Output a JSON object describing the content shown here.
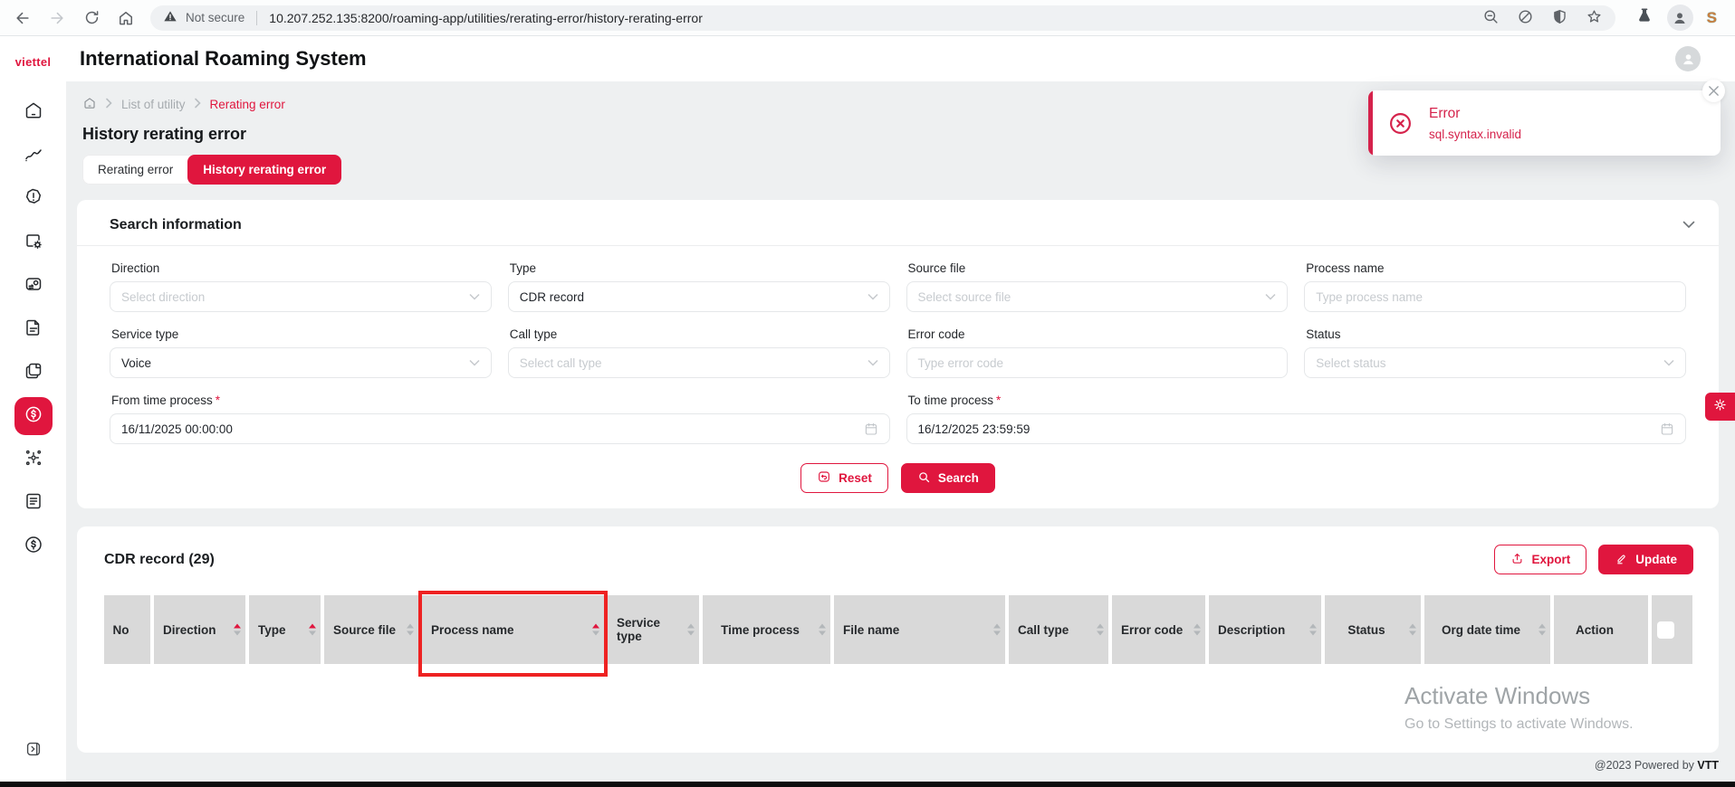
{
  "colors": {
    "accent": "#e0163e",
    "accent2": "#d5224b",
    "annotation": "#ee2222",
    "headerbg": "#d9d9d9",
    "bg": "#eef0f1",
    "placeholder": "#c7cbcf",
    "text": "#202428"
  },
  "browser": {
    "not_secure": "Not secure",
    "url": "10.207.252.135:8200/roaming-app/utilities/rerating-error/history-rerating-error",
    "extension_badge": "S"
  },
  "sidebar": {
    "logo": "viettel",
    "icons": [
      "home",
      "line-chart",
      "alert-hexagon",
      "chip-settings",
      "media-refresh",
      "document",
      "pages",
      "dollar-square",
      "network-nodes",
      "report-list",
      "dollar-circle"
    ],
    "active_icon": "dollar-square"
  },
  "header": {
    "title": "International Roaming System"
  },
  "breadcrumb": {
    "items": [
      "List of utility",
      "Rerating error"
    ]
  },
  "page": {
    "title": "History rerating error"
  },
  "tabs": [
    {
      "label": "Rerating error",
      "active": false
    },
    {
      "label": "History rerating error",
      "active": true
    }
  ],
  "toast": {
    "title": "Error",
    "message": "sql.syntax.invalid"
  },
  "search": {
    "title": "Search information",
    "required_mark": "*",
    "fields": {
      "direction": {
        "label": "Direction",
        "placeholder": "Select direction"
      },
      "type": {
        "label": "Type",
        "value": "CDR record"
      },
      "source_file": {
        "label": "Source file",
        "placeholder": "Select source file"
      },
      "process_name": {
        "label": "Process name",
        "placeholder": "Type process name"
      },
      "service_type": {
        "label": "Service type",
        "value": "Voice"
      },
      "call_type": {
        "label": "Call type",
        "placeholder": "Select call type"
      },
      "error_code": {
        "label": "Error code",
        "placeholder": "Type error code"
      },
      "status": {
        "label": "Status",
        "placeholder": "Select status"
      },
      "from_time": {
        "label": "From time process",
        "value": "16/11/2025 00:00:00",
        "required": true
      },
      "to_time": {
        "label": "To time process",
        "value": "16/12/2025 23:59:59",
        "required": true
      }
    },
    "buttons": {
      "reset": "Reset",
      "search": "Search"
    }
  },
  "results": {
    "title": "CDR record (29)",
    "export_label": "Export",
    "update_label": "Update",
    "annotated_column_index": 4,
    "columns": [
      {
        "label": "No",
        "sort": "none"
      },
      {
        "label": "Direction",
        "sort": "asc"
      },
      {
        "label": "Type",
        "sort": "asc"
      },
      {
        "label": "Source file",
        "sort": "both"
      },
      {
        "label": "Process name",
        "sort": "asc"
      },
      {
        "label": "Service type",
        "sort": "both"
      },
      {
        "label": "Time process",
        "sort": "both"
      },
      {
        "label": "File name",
        "sort": "both"
      },
      {
        "label": "Call type",
        "sort": "both"
      },
      {
        "label": "Error code",
        "sort": "both"
      },
      {
        "label": "Description",
        "sort": "both"
      },
      {
        "label": "Status",
        "sort": "both"
      },
      {
        "label": "Org date time",
        "sort": "both"
      },
      {
        "label": "Action",
        "sort": "none"
      },
      {
        "label": "",
        "sort": "none"
      }
    ]
  },
  "watermark": {
    "line1": "Activate Windows",
    "line2": "Go to Settings to activate Windows."
  },
  "footer": {
    "text": "@2023 Powered by",
    "brand": "VTT"
  }
}
